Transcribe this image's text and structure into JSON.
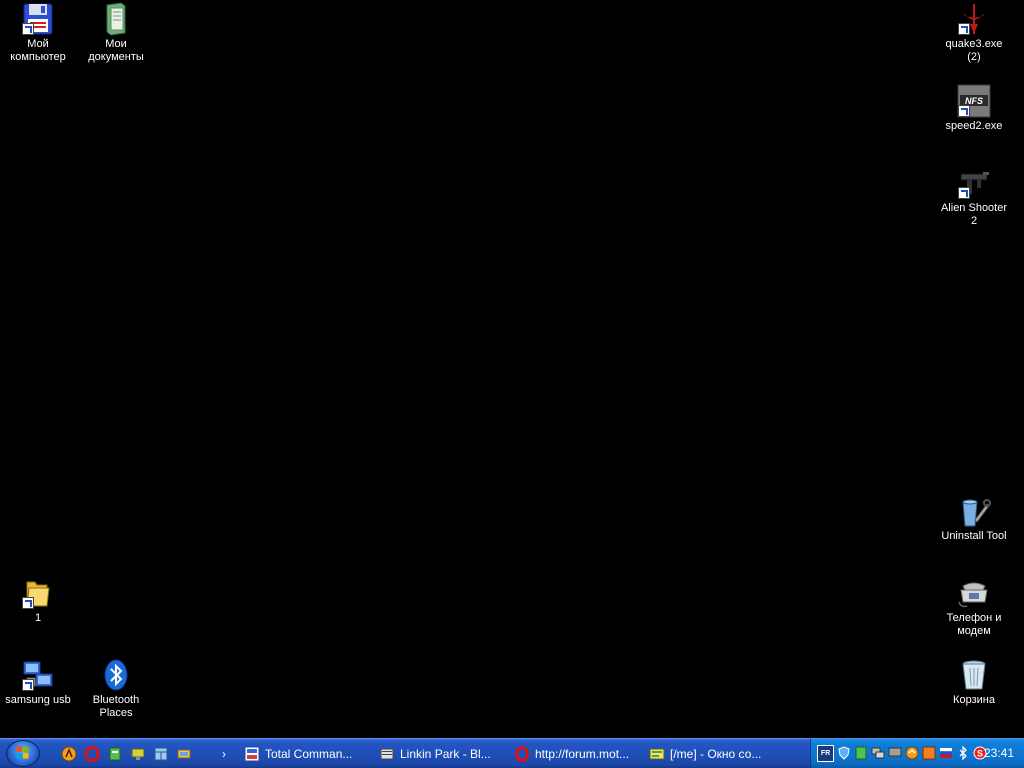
{
  "desktop": {
    "icons": {
      "my_computer": "Мой компьютер",
      "my_documents": "Мои документы",
      "quake3": "quake3.exe (2)",
      "speed2": "speed2.exe",
      "alien_shooter": "Alien Shooter 2",
      "uninstall_tool": "Uninstall Tool",
      "folder_1": "1",
      "phone_modem": "Телефон и модем",
      "samsung_usb": "samsung usb",
      "bluetooth": "Bluetooth Places",
      "recycle_bin": "Корзина"
    }
  },
  "taskbar": {
    "quicklaunch_icons": [
      "aimp-icon",
      "opera-icon",
      "utility-icon",
      "network-icon",
      "window-icon",
      "tray-app-icon"
    ],
    "chevron": "›",
    "tasks": [
      {
        "label": "Total Comman...",
        "icon": "total-commander-icon"
      },
      {
        "label": "Linkin Park - Bl...",
        "icon": "media-player-icon"
      },
      {
        "label": "http://forum.mot...",
        "icon": "opera-icon"
      },
      {
        "label": "[/me] - Окно со...",
        "icon": "chat-window-icon"
      }
    ],
    "tray": {
      "lang_badge": "FR",
      "clock": "23:41"
    }
  },
  "colors": {
    "taskbar": "#2456c4",
    "tray": "#0f7ed8",
    "desktop": "#000000"
  }
}
